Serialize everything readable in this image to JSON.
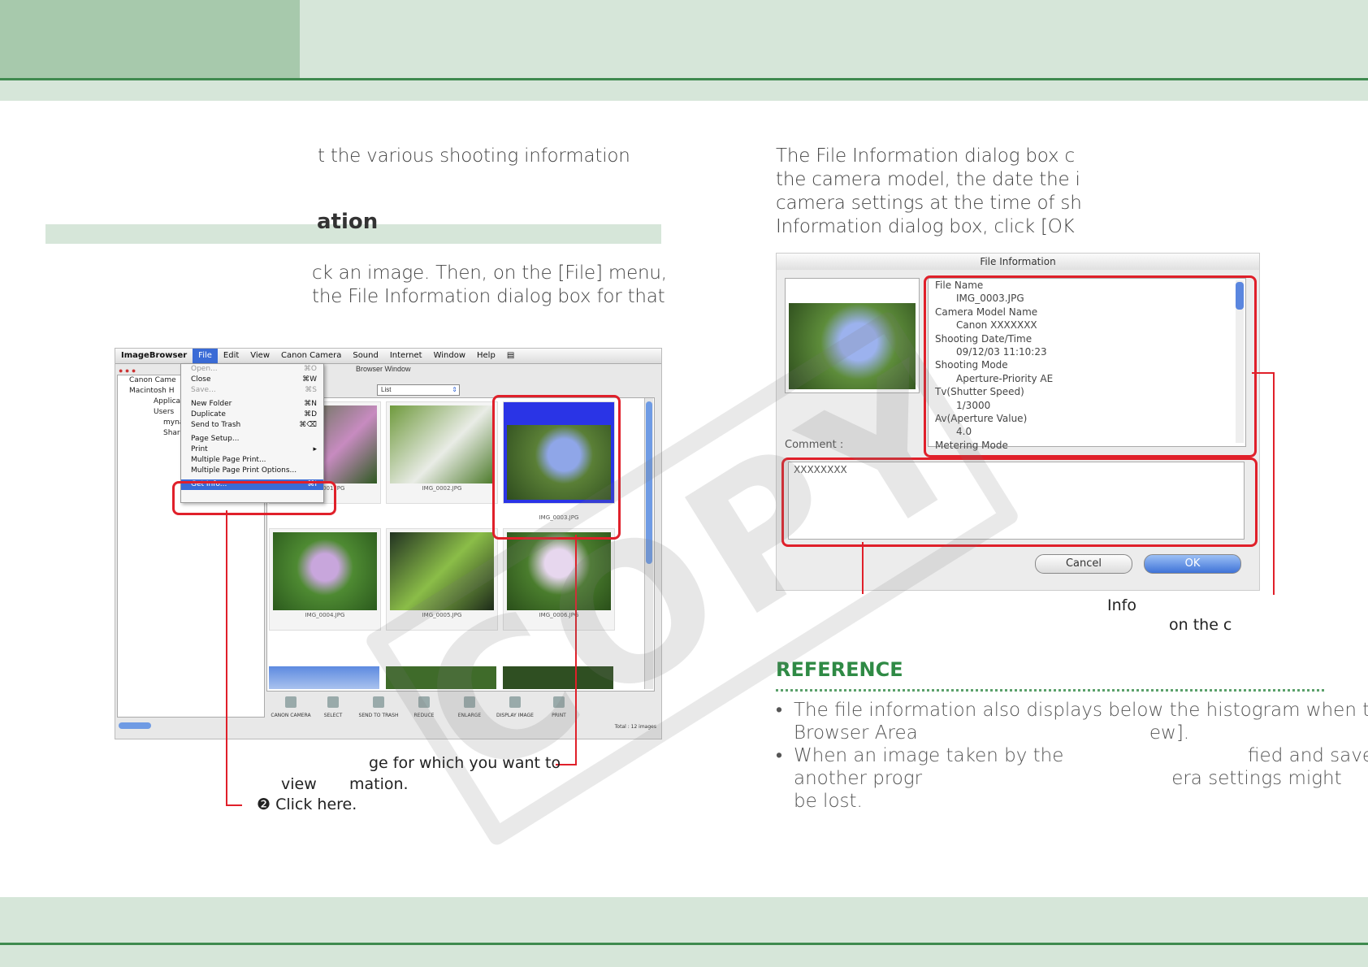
{
  "left_column": {
    "intro_line": "t the various shooting information",
    "section_title": "ation",
    "step_text": [
      "ck an image. Then, on the [File] menu,",
      " the File Information dialog box for that"
    ]
  },
  "image_browser": {
    "menubar": [
      "ImageBrowser",
      "File",
      "Edit",
      "View",
      "Canon Camera",
      "Sound",
      "Internet",
      "Window",
      "Help"
    ],
    "window_title": "Browser Window",
    "view_select": "List",
    "sidebar": [
      "Canon Came",
      "Macintosh H",
      "Applicatio",
      "Users",
      "myna",
      "Share"
    ],
    "file_menu": [
      {
        "label": "Open...",
        "key": "⌘O",
        "dim": true
      },
      {
        "label": "Close",
        "key": "⌘W",
        "dim": false
      },
      {
        "label": "Save...",
        "key": "⌘S",
        "dim": true
      },
      {
        "label": "New Folder",
        "key": "⌘N",
        "dim": false
      },
      {
        "label": "Duplicate",
        "key": "⌘D",
        "dim": false
      },
      {
        "label": "Send to Trash",
        "key": "⌘⌫",
        "dim": false
      },
      {
        "label": "Page Setup...",
        "key": "",
        "dim": false
      },
      {
        "label": "Print",
        "key": "▸",
        "dim": false
      },
      {
        "label": "Multiple Page Print...",
        "key": "",
        "dim": false
      },
      {
        "label": "Multiple Page Print Options...",
        "key": "",
        "dim": false
      },
      {
        "label": "Get Info...",
        "key": "⌘I",
        "dim": false
      }
    ],
    "thumbnails": [
      "IMG_0001.JPG",
      "IMG_0002.JPG",
      "IMG_0003.JPG",
      "IMG_0004.JPG",
      "IMG_0005.JPG",
      "IMG_0006.JPG"
    ],
    "toolbar": [
      "CANON CAMERA",
      "SELECT",
      "SEND TO TRASH",
      "REDUCE",
      "ENLARGE",
      "DISPLAY IMAGE",
      "PRINT"
    ],
    "status": "Total : 12 images"
  },
  "callouts": {
    "select_line1": "ge for which you want to",
    "select_line2a": "view",
    "select_line2b": "mation.",
    "click_num": "❷",
    "click_text": "Click here."
  },
  "right_column": {
    "intro": [
      "The File Information dialog box c",
      "the camera model, the date the i",
      "camera settings at the time of sh",
      "Information dialog box, click [OK"
    ],
    "info_label": "Info",
    "on_the_label": "on the c"
  },
  "file_info_dialog": {
    "title": "File Information",
    "rows": [
      {
        "text": "File Name",
        "value": false
      },
      {
        "text": "IMG_0003.JPG",
        "value": true
      },
      {
        "text": "Camera Model Name",
        "value": false
      },
      {
        "text": "Canon XXXXXXX",
        "value": true
      },
      {
        "text": "Shooting Date/Time",
        "value": false
      },
      {
        "text": "09/12/03 11:10:23",
        "value": true
      },
      {
        "text": "Shooting Mode",
        "value": false
      },
      {
        "text": "Aperture-Priority AE",
        "value": true
      },
      {
        "text": "Tv(Shutter Speed)",
        "value": false
      },
      {
        "text": "1/3000",
        "value": true
      },
      {
        "text": "Av(Aperture Value)",
        "value": false
      },
      {
        "text": "4.0",
        "value": true
      },
      {
        "text": "Metering Mode",
        "value": false
      }
    ],
    "comment_label": "Comment :",
    "comment_value": "XXXXXXXX",
    "cancel": "Cancel",
    "ok": "OK"
  },
  "reference": {
    "title": "REFERENCE",
    "items": [
      [
        "The file information also displays below the histogram when the",
        "Browser Area                                       ew]."
      ],
      [
        "When an image taken by the                               fied and saved by",
        "another progr                                          era settings might",
        "be lost."
      ]
    ]
  },
  "watermark": "COPY",
  "colors": {
    "accent_green": "#2f8a45",
    "band_green": "#d6e6d9",
    "tab_green": "#a7c9ac",
    "highlight_red": "#e0202a"
  }
}
